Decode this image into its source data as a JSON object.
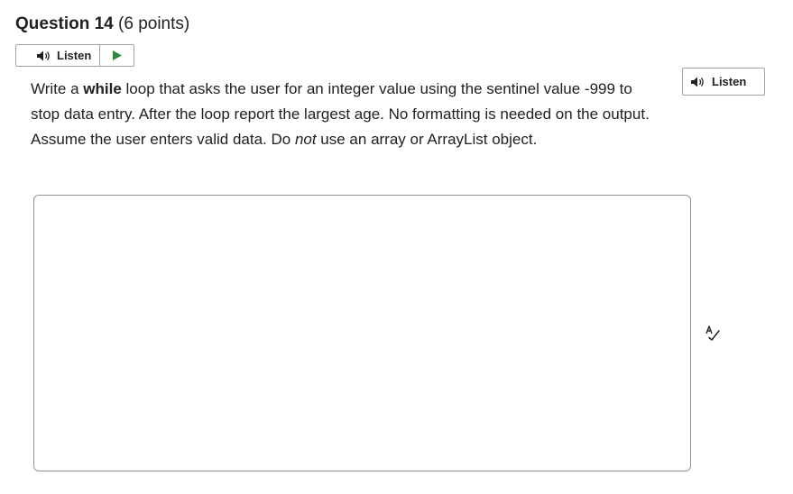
{
  "question": {
    "label": "Question 14",
    "points": "(6 points)"
  },
  "listen": {
    "label": "Listen",
    "side_label": "Listen"
  },
  "prompt": {
    "part1": "Write a ",
    "keyword": "while",
    "part2": " loop that asks the user for an integer value using the sentinel value -999 to stop data entry.  After the loop report the largest age.  No formatting is needed on the output. Assume the user enters valid data. Do ",
    "emphasis": "not",
    "part3": " use an array or ArrayList object."
  },
  "answer": {
    "value": ""
  },
  "icons": {
    "speaker": "speaker-icon",
    "play": "play-icon",
    "spellcheck": "spellcheck-icon"
  },
  "colors": {
    "play_green": "#2e8b3a",
    "border": "#a0a4a8",
    "text": "#202122"
  }
}
